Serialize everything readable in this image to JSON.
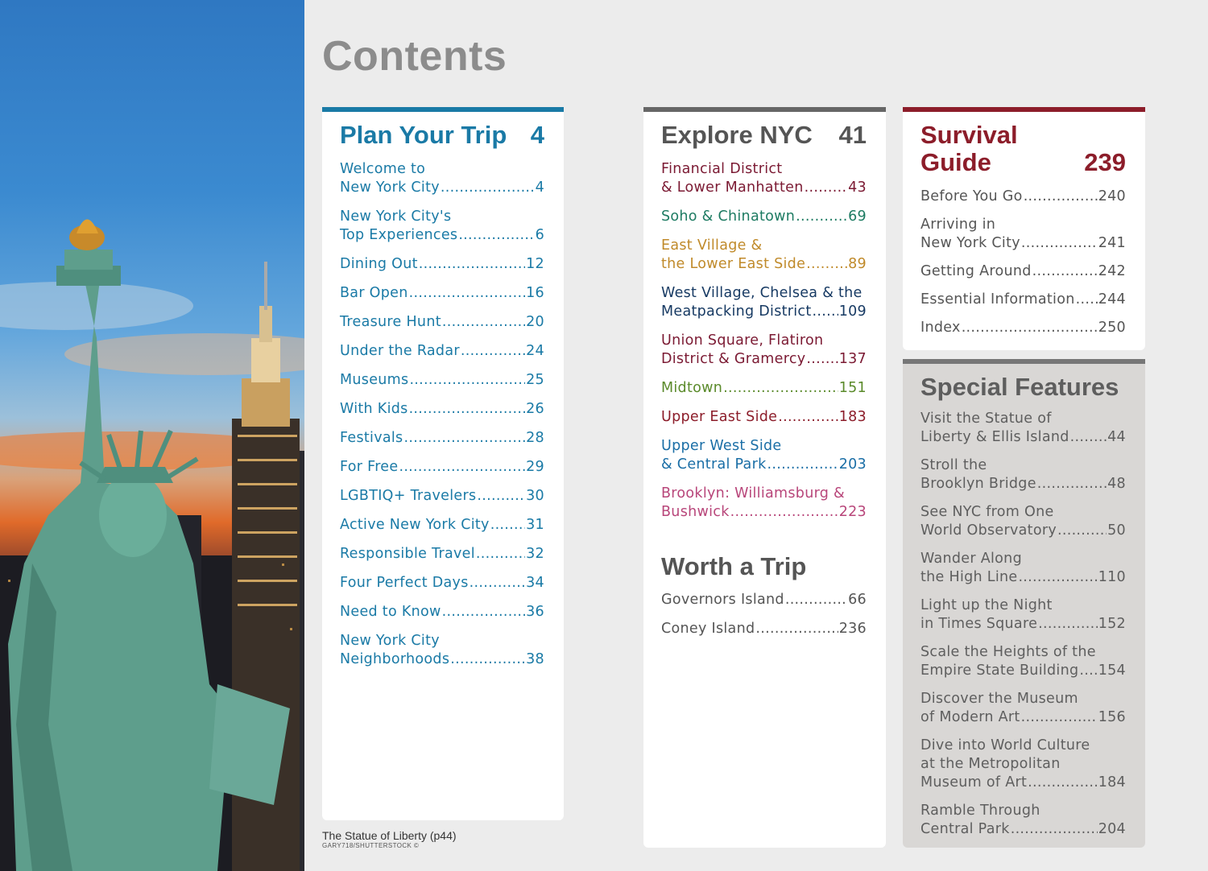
{
  "title": "Contents",
  "caption": {
    "title": "The Statue of Liberty (p44)",
    "credit": "GARY718/SHUTTERSTOCK ©"
  },
  "colors": {
    "plan": "#1a7aa6",
    "explore": "#555555",
    "survival": "#8c1d2a",
    "special": "#5e5e5e",
    "financial": "#7b1a33",
    "soho": "#1d7b62",
    "eastvillage": "#c08a2a",
    "westvillage": "#173a63",
    "union": "#7b1a33",
    "midtown": "#5a8a2a",
    "uppereast": "#8c1d2a",
    "upperwest": "#1a6ea6",
    "brooklyn": "#b8467a"
  },
  "plan": {
    "title": "Plan Your Trip",
    "page": "4",
    "items": [
      {
        "l1": "Welcome to",
        "l2": "New York City",
        "p": "4"
      },
      {
        "l1": "",
        "l2": "",
        "p": ""
      },
      {
        "l1": "New York City's",
        "l2": "Top Experiences",
        "p": "6"
      },
      {
        "l2": "Dining Out",
        "p": "12"
      },
      {
        "l2": "Bar Open",
        "p": "16"
      },
      {
        "l2": "Treasure Hunt",
        "p": "20"
      },
      {
        "l2": "Under the Radar",
        "p": "24"
      },
      {
        "l2": "Museums",
        "p": "25"
      },
      {
        "l2": "With Kids",
        "p": "26"
      },
      {
        "l2": "Festivals",
        "p": "28"
      },
      {
        "l2": "For Free",
        "p": "29"
      },
      {
        "l2": "LGBTIQ+ Travelers",
        "p": "30"
      },
      {
        "l2": "Active New York City",
        "p": "31"
      },
      {
        "l2": "Responsible Travel",
        "p": "32"
      },
      {
        "l2": "Four Perfect Days",
        "p": "34"
      },
      {
        "l2": "Need to Know",
        "p": "36"
      },
      {
        "l1": "New York City",
        "l2": "Neighborhoods",
        "p": "38"
      }
    ]
  },
  "explore": {
    "title": "Explore NYC",
    "page": "41",
    "items": [
      {
        "l1": "Financial District",
        "l2": "& Lower Manhatten",
        "p": "43"
      },
      {
        "l2": "Soho & Chinatown",
        "p": "69"
      },
      {
        "l1": "East Village &",
        "l2": "the Lower East Side",
        "p": "89"
      },
      {
        "l1": "West Village, Chelsea & the",
        "l2": "Meatpacking District",
        "p": "109"
      },
      {
        "l1": "Union Square, Flatiron",
        "l2": "District & Gramercy",
        "p": "137"
      },
      {
        "l2": "Midtown",
        "p": "151"
      },
      {
        "l2": "Upper East Side",
        "p": "183"
      },
      {
        "l1": "Upper West Side",
        "l2": "& Central Park",
        "p": "203"
      },
      {
        "l1": "Brooklyn: Williamsburg &",
        "l2": "Bushwick",
        "p": "223"
      }
    ],
    "worth_title": "Worth a Trip",
    "worth": [
      {
        "l2": "Governors Island",
        "p": "66"
      },
      {
        "l2": "Coney Island",
        "p": "236"
      }
    ]
  },
  "survival": {
    "title1": "Survival",
    "title2": "Guide",
    "page": "239",
    "items": [
      {
        "l2": "Before You Go",
        "p": "240"
      },
      {
        "l1": "Arriving in",
        "l2": "New York City",
        "p": "241"
      },
      {
        "l2": "Getting Around",
        "p": "242"
      },
      {
        "l2": "Essential Information",
        "p": "244"
      },
      {
        "l2": "Index",
        "p": "250"
      }
    ]
  },
  "special": {
    "title": "Special Features",
    "items": [
      {
        "l1": "Visit the Statue of",
        "l2": "Liberty & Ellis Island",
        "p": "44"
      },
      {
        "l1": "Stroll the",
        "l2": "Brooklyn Bridge",
        "p": "48"
      },
      {
        "l1": "See NYC from One",
        "l2": "World Observatory",
        "p": "50"
      },
      {
        "l1": "Wander Along",
        "l2": "the High Line",
        "p": "110"
      },
      {
        "l1": "Light up the Night",
        "l2": "in Times Square",
        "p": "152"
      },
      {
        "l1": "Scale the Heights of the",
        "l2": "Empire State Building",
        "p": "154"
      },
      {
        "l1": "Discover the Museum",
        "l2": "of Modern Art",
        "p": "156"
      },
      {
        "l0": "Dive into World Culture",
        "l1": "at the Metropolitan",
        "l2": "Museum of Art",
        "p": "184"
      },
      {
        "l1": "Ramble Through",
        "l2": "Central Park",
        "p": "204"
      }
    ]
  }
}
